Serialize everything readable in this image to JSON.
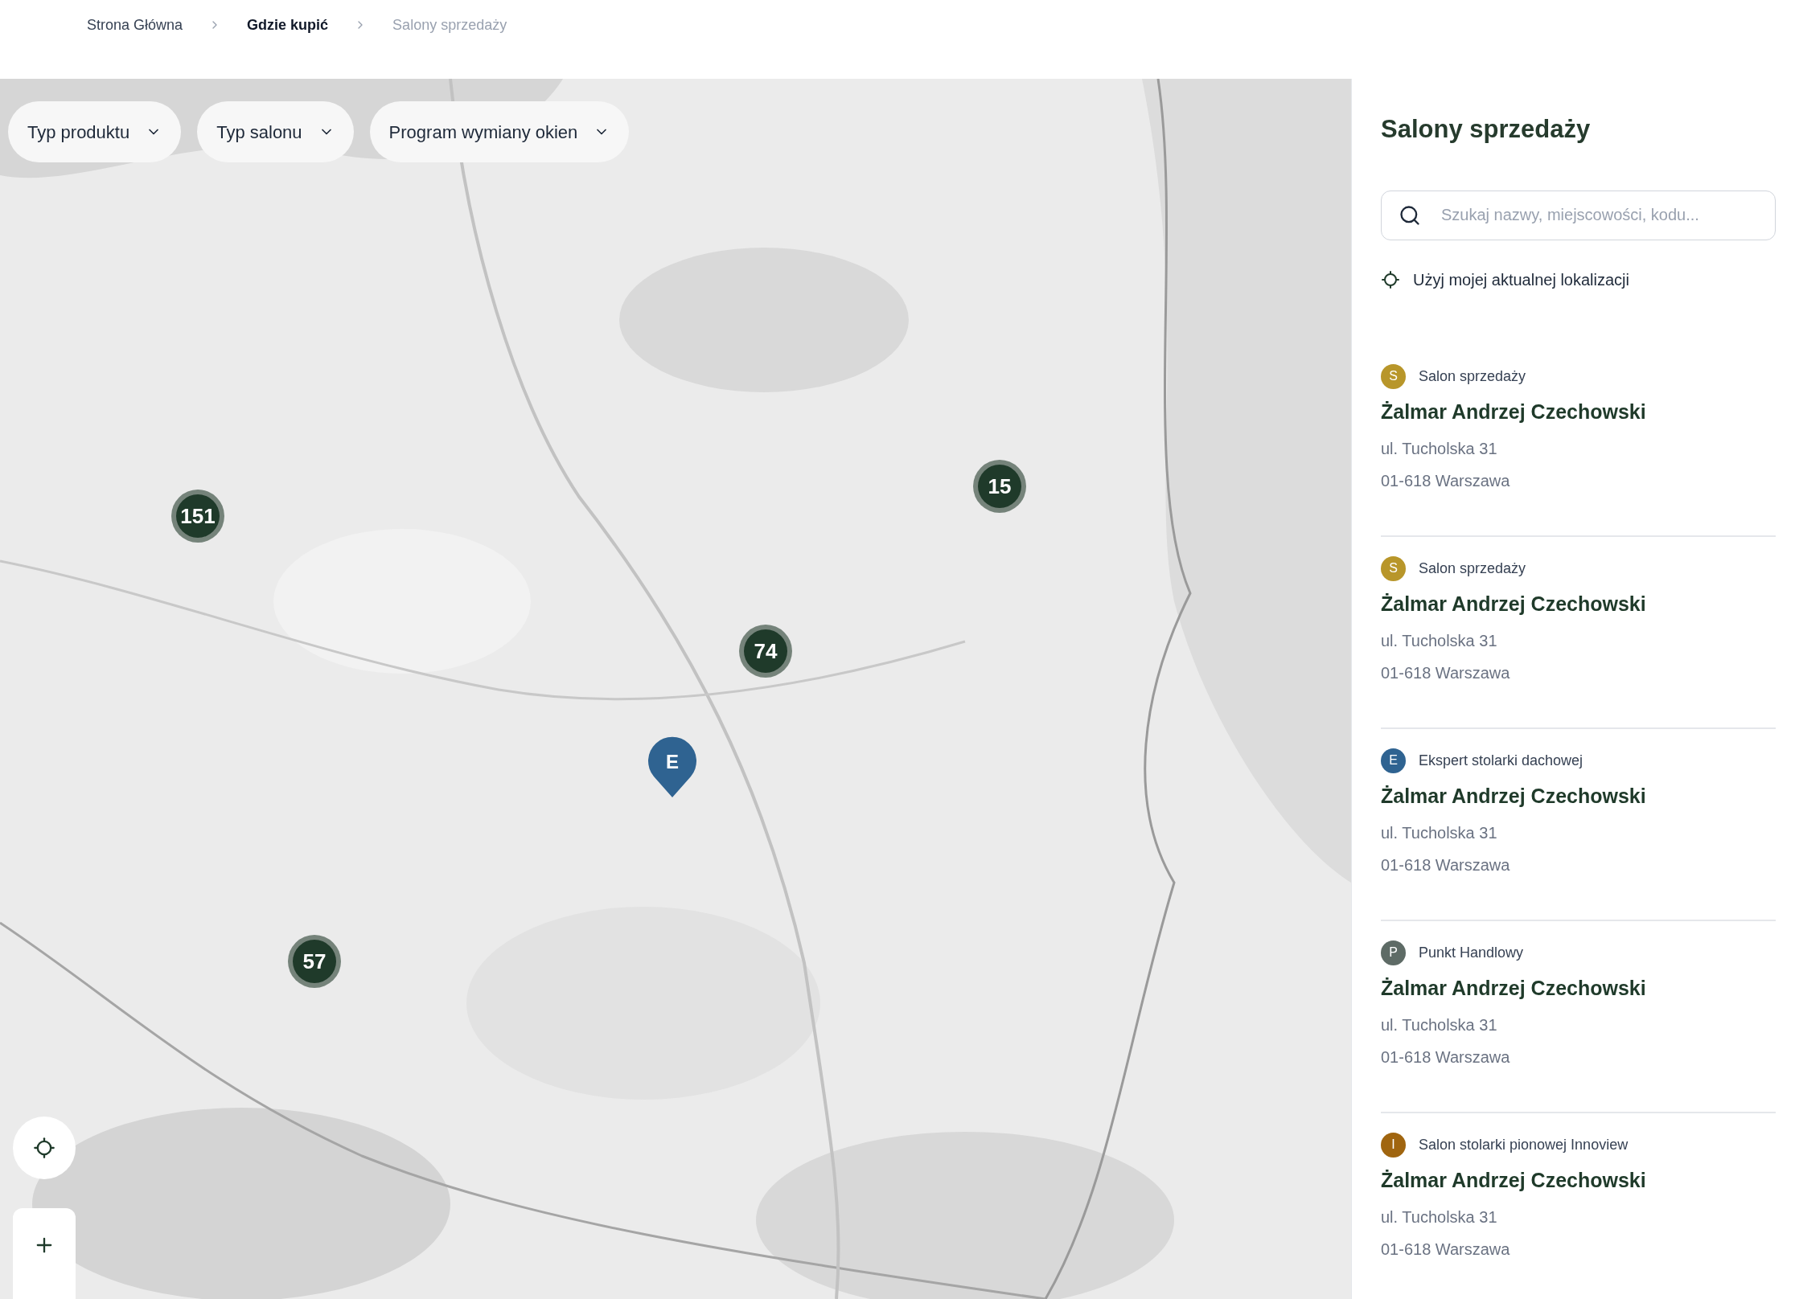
{
  "breadcrumbs": [
    {
      "label": "Strona Główna",
      "current": false,
      "bold": false
    },
    {
      "label": "Gdzie kupić",
      "current": false,
      "bold": true
    },
    {
      "label": "Salony sprzedaży",
      "current": true,
      "bold": false
    }
  ],
  "filters": [
    {
      "label": "Typ produktu"
    },
    {
      "label": "Typ salonu"
    },
    {
      "label": "Program wymiany okien"
    }
  ],
  "map_markers": [
    {
      "kind": "cluster",
      "label": "151"
    },
    {
      "kind": "cluster",
      "label": "15"
    },
    {
      "kind": "cluster",
      "label": "74"
    },
    {
      "kind": "cluster",
      "label": "57"
    },
    {
      "kind": "pin",
      "label": "E",
      "color": "#2f6391"
    }
  ],
  "sidebar": {
    "title": "Salony sprzedaży",
    "search": {
      "placeholder": "Szukaj nazwy, miejscowości, kodu..."
    },
    "location_link": "Użyj mojej aktualnej lokalizacji",
    "items": [
      {
        "badge": "S",
        "color": "#b8962a",
        "type": "Salon sprzedaży",
        "name": "Żalmar Andrzej Czechowski",
        "street": "ul. Tucholska 31",
        "city": "01-618 Warszawa"
      },
      {
        "badge": "S",
        "color": "#b8962a",
        "type": "Salon sprzedaży",
        "name": "Żalmar Andrzej Czechowski",
        "street": "ul. Tucholska 31",
        "city": "01-618 Warszawa"
      },
      {
        "badge": "E",
        "color": "#2f6391",
        "type": "Ekspert stolarki dachowej",
        "name": "Żalmar Andrzej Czechowski",
        "street": "ul. Tucholska 31",
        "city": "01-618 Warszawa"
      },
      {
        "badge": "P",
        "color": "#5e6b66",
        "type": "Punkt Handlowy",
        "name": "Żalmar Andrzej Czechowski",
        "street": "ul. Tucholska 31",
        "city": "01-618 Warszawa"
      },
      {
        "badge": "I",
        "color": "#a0650f",
        "type": "Salon stolarki pionowej Innoview",
        "name": "Żalmar Andrzej Czechowski",
        "street": "ul. Tucholska 31",
        "city": "01-618 Warszawa"
      }
    ]
  }
}
